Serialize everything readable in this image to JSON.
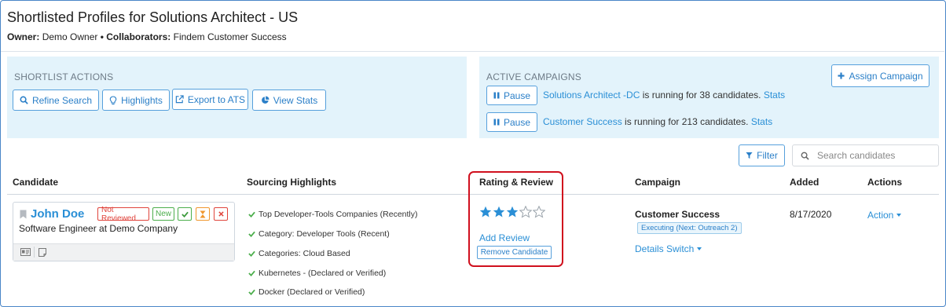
{
  "header": {
    "title": "Shortlisted Profiles for Solutions Architect - US",
    "owner_label": "Owner:",
    "owner_value": "Demo Owner",
    "separator": "•",
    "collaborators_label": "Collaborators:",
    "collaborators_value": "Findem Customer Success"
  },
  "shortlist_actions": {
    "title": "SHORTLIST ACTIONS",
    "buttons": [
      {
        "label": "Refine Search",
        "icon": "search-icon"
      },
      {
        "label": "Highlights",
        "icon": "lightbulb-icon"
      },
      {
        "label": "Export to ATS",
        "icon": "external-link-icon"
      },
      {
        "label": "View Stats",
        "icon": "pie-chart-icon"
      }
    ]
  },
  "active_campaigns": {
    "title": "ACTIVE CAMPAIGNS",
    "assign_label": "Assign Campaign",
    "campaigns": [
      {
        "pause_label": "Pause",
        "name": "Solutions Architect -DC",
        "text": " is running for 38 candidates. ",
        "stats_label": "Stats"
      },
      {
        "pause_label": "Pause",
        "name": "Customer Success",
        "text": " is running for 213 candidates. ",
        "stats_label": "Stats"
      }
    ]
  },
  "toolbar": {
    "filter_label": "Filter",
    "search_placeholder": "Search candidates"
  },
  "table": {
    "headers": [
      "Candidate",
      "Sourcing Highlights",
      "Rating & Review",
      "Campaign",
      "Added",
      "Actions"
    ],
    "row": {
      "candidate_name": "John Doe",
      "candidate_title": "Software Engineer at Demo Company",
      "badge_not_reviewed": "Not Reviewed",
      "badge_new": "New",
      "highlights": [
        "Top Developer-Tools Companies (Recently)",
        "Category: Developer Tools (Recent)",
        "Categories: Cloud Based",
        "Kubernetes - (Declared or Verified)",
        "Docker (Declared or Verified)"
      ],
      "rating": 3,
      "rating_max": 5,
      "add_review_label": "Add Review",
      "remove_label": "Remove Candidate",
      "campaign_name": "Customer Success",
      "campaign_status": "Executing (Next: Outreach 2)",
      "details_label": "Details Switch",
      "added": "8/17/2020",
      "action_label": "Action"
    }
  },
  "colors": {
    "accent": "#2a8fd6",
    "panel_bg": "#e3f3fb",
    "highlight_border": "#d0101e",
    "star_fill": "#2a8fd6",
    "badge_red": "#e0443c",
    "badge_green": "#4cae4c",
    "badge_orange": "#f0962e"
  }
}
